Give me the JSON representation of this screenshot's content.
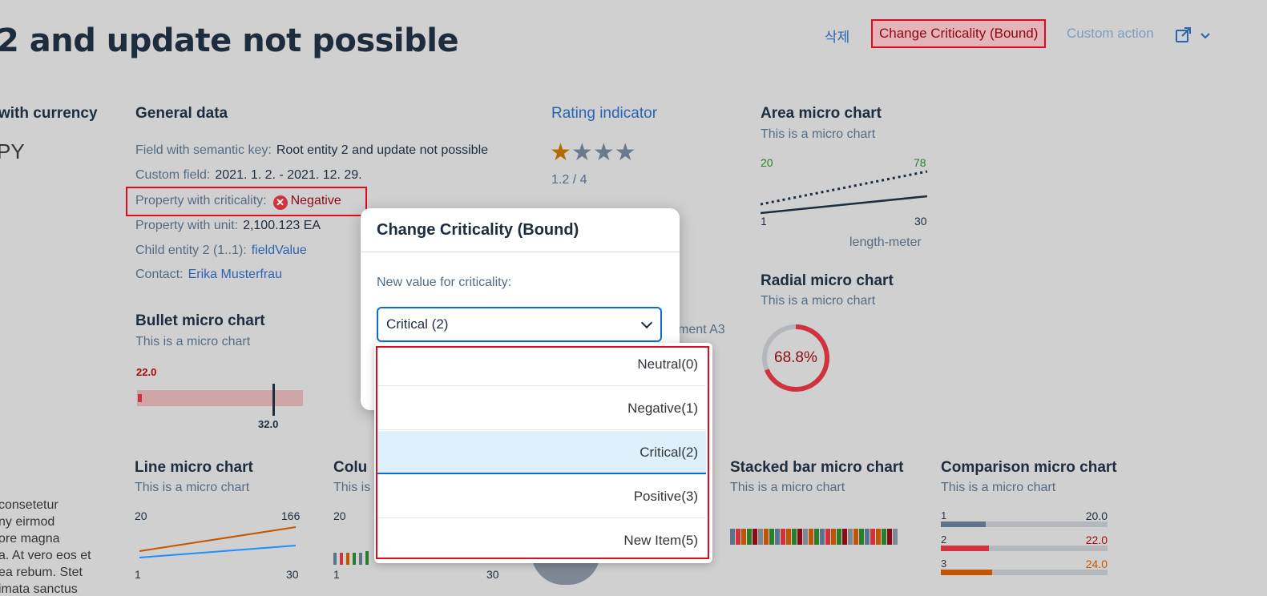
{
  "header": {
    "title": "2 and update not possible",
    "actions": [
      "삭제",
      "Change Criticality (Bound)",
      "Custom action"
    ]
  },
  "left_fragments": {
    "currency_title": "with currency",
    "currency_value": "PY",
    "text_lines": [
      "consetetur",
      "ny eirmod",
      "ore magna",
      "a. At vero eos et",
      "ea rebum. Stet",
      "imata sanctus"
    ]
  },
  "general": {
    "title": "General data",
    "fields": [
      {
        "label": "Field with semantic key:",
        "value": "Root entity 2 and update not possible"
      },
      {
        "label": "Custom field:",
        "value": "2021. 1. 2. - 2021. 12. 29."
      },
      {
        "label": "Property with criticality:",
        "value": "Negative"
      },
      {
        "label": "Property with unit:",
        "value": "2,100.123 EA"
      },
      {
        "label": "Child entity 2 (1..1):",
        "value": "fieldValue"
      },
      {
        "label": "Contact:",
        "value": "Erika Musterfrau"
      }
    ]
  },
  "rating": {
    "title": "Rating indicator",
    "value": 1.2,
    "max": 4,
    "text": "1.2 / 4"
  },
  "area_chart": {
    "title": "Area micro chart",
    "subtitle": "This is a micro chart",
    "left_top": "20",
    "right_top": "78",
    "left_bottom": "1",
    "right_bottom": "30",
    "unit": "length-meter"
  },
  "radial_chart": {
    "title": "Radial micro chart",
    "subtitle": "This is a micro chart",
    "value_text": "68.8%",
    "percent": 68.8
  },
  "bullet_chart": {
    "title": "Bullet micro chart",
    "subtitle": "This is a micro chart",
    "actual": "22.0",
    "target": "32.0"
  },
  "behind_dialog_text": "ment A3",
  "line_chart": {
    "title": "Line micro chart",
    "subtitle": "This is a micro chart",
    "left_top": "20",
    "right_top": "166",
    "left_bottom": "1",
    "right_bottom": "30"
  },
  "column_chart": {
    "title": "Colu",
    "subtitle": "This is",
    "left_top": "20",
    "left_bottom": "1",
    "right_bottom": "30"
  },
  "stacked_chart": {
    "title": "Stacked bar micro chart",
    "subtitle": "This is a micro chart"
  },
  "comparison_chart": {
    "title": "Comparison micro chart",
    "subtitle": "This is a micro chart",
    "rows": [
      {
        "label": "1",
        "value": "20.0",
        "fraction": 0.27,
        "color": "#5b738b",
        "value_color": "#1d2d3e"
      },
      {
        "label": "2",
        "value": "22.0",
        "fraction": 0.29,
        "color": "#d13240",
        "value_color": "#aa0808"
      },
      {
        "label": "3",
        "value": "24.0",
        "fraction": 0.31,
        "color": "#c35500",
        "value_color": "#c35500"
      }
    ]
  },
  "dialog": {
    "title": "Change Criticality (Bound)",
    "label": "New value for criticality:",
    "selected": "Critical (2)",
    "options": [
      "Neutral(0)",
      "Negative(1)",
      "Critical(2)",
      "Positive(3)",
      "New Item(5)"
    ],
    "selected_index": 2
  },
  "colors": {
    "negative": "#d13240",
    "link": "#2a63b4",
    "accent": "#0a6ed1"
  }
}
